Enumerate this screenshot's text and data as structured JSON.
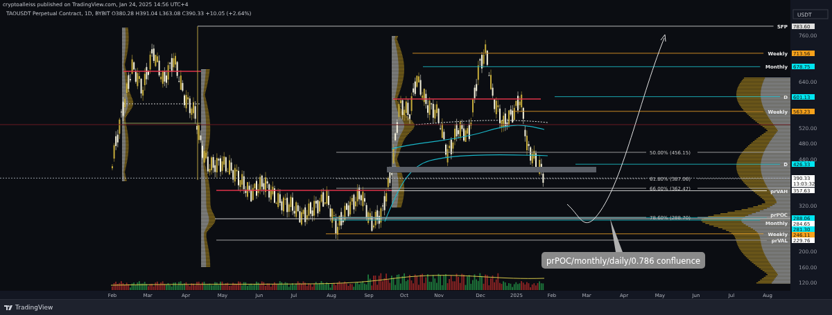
{
  "header": {
    "publisher_line": "cryptoalleiss published on TradingView.com, Jan 24, 2025 14:56 UTC+4",
    "symbol_line": "TAOUSDT Perpetual Contract, 1D, BYBIT O380.28 H391.04 L363.08 C390.33 +10.05 (+2.64%)"
  },
  "axis": {
    "unit": "USDT",
    "y_labels": [
      "760.00",
      "640.00",
      "520.00",
      "480.00",
      "440.00",
      "320.00",
      "200.00",
      "160.00",
      "120.00"
    ],
    "x_labels": [
      "Feb",
      "Mar",
      "Apr",
      "May",
      "Jun",
      "Jul",
      "Aug",
      "Sep",
      "Oct",
      "Nov",
      "Dec",
      "2025",
      "Feb",
      "Mar",
      "Apr",
      "May",
      "Jun",
      "Jul",
      "Aug"
    ]
  },
  "levels": [
    {
      "label": "SFP",
      "tag": "783.60",
      "color": "#e0e0e0"
    },
    {
      "label": "Weekly",
      "tag": "713.56",
      "color": "#f7a21b"
    },
    {
      "label": "Monthly",
      "tag": "678.75",
      "color": "#00e5f0"
    },
    {
      "label": "D",
      "tag": "601.13",
      "color": "#00e5f0"
    },
    {
      "label": "Weekly",
      "tag": "563.23",
      "color": "#f7a21b"
    },
    {
      "label": "D",
      "tag": "426.33",
      "color": "#00e5f0"
    },
    {
      "tag": "390.33",
      "countdown": "13:03:32",
      "color": "#ffffff"
    },
    {
      "label": "prVAH",
      "tag": "357.63",
      "color": "#ffffff"
    },
    {
      "label": "prPOC",
      "tag": "288.06",
      "color": "#00e5f0"
    },
    {
      "tag": "284.65",
      "color": "#ffffff"
    },
    {
      "label": "Monthly",
      "tag": "281.30",
      "color": "#00e5f0"
    },
    {
      "label": "Weekly",
      "tag": "246.11",
      "color": "#f7a21b"
    },
    {
      "label": "prVAL",
      "tag": "229.76",
      "color": "#ffffff"
    }
  ],
  "fibonacci": [
    {
      "text": "50.00% (456.15)"
    },
    {
      "text": "61.80% (387.06)"
    },
    {
      "text": "66.00% (362.47)"
    },
    {
      "text": "78.60% (288.70)"
    }
  ],
  "callout": {
    "text": "prPOC/monthly/daily/0.786 confluence"
  },
  "footer": {
    "brand": "TradingView"
  }
}
